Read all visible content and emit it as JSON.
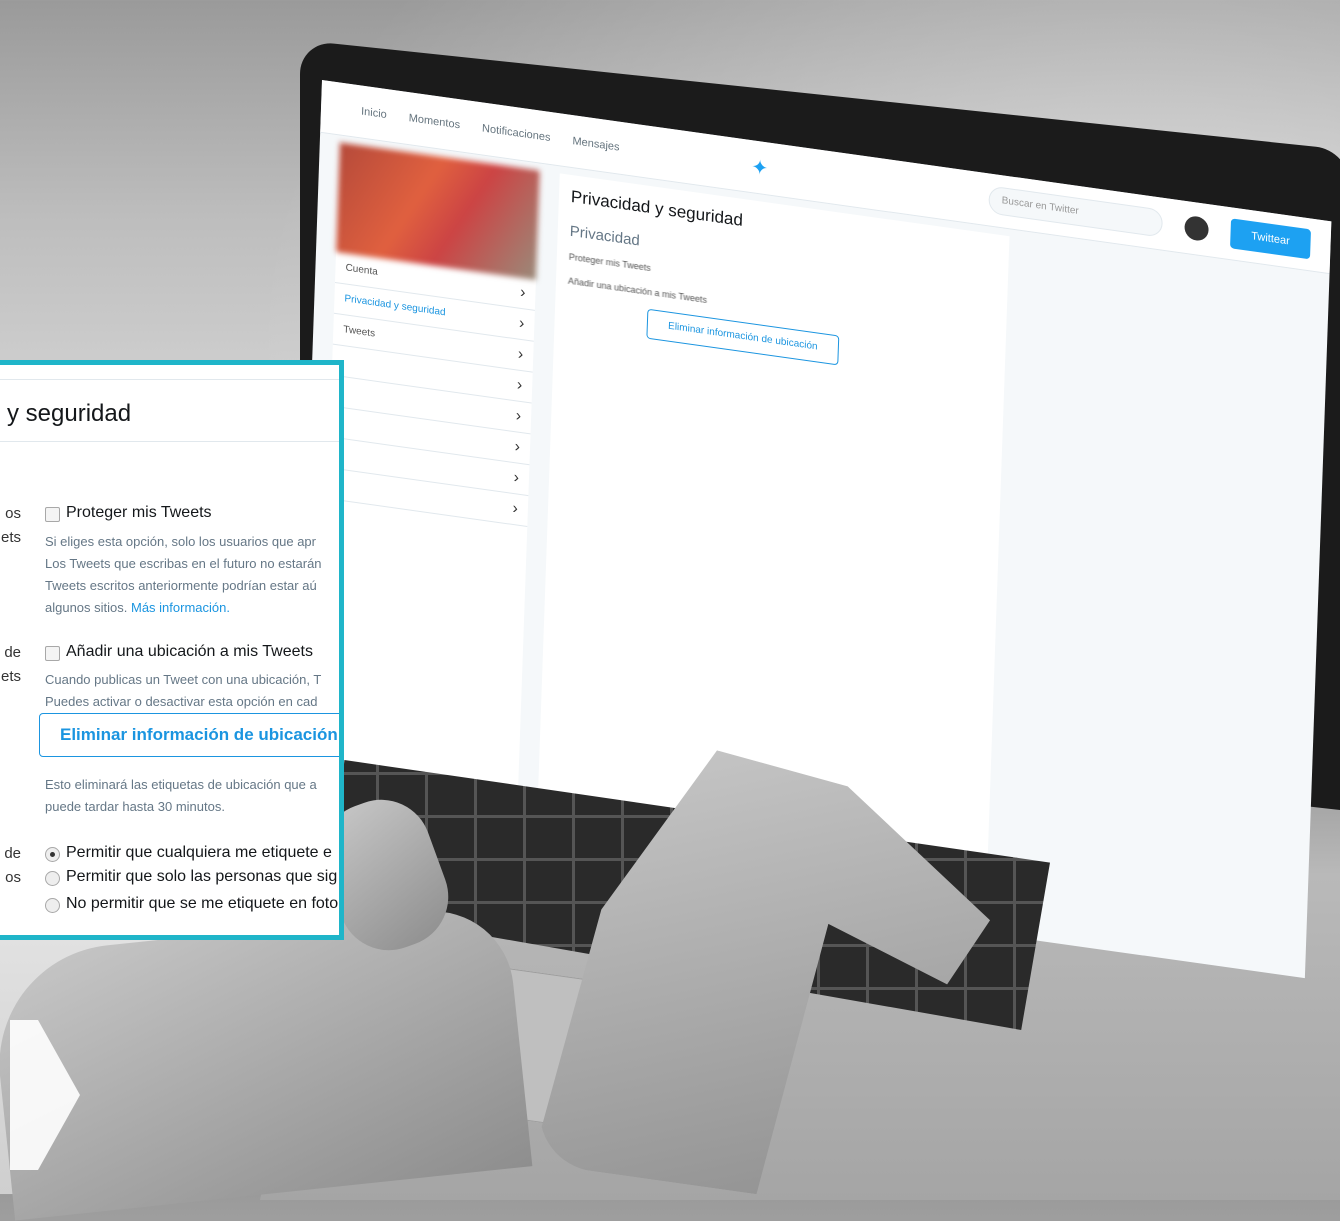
{
  "screen": {
    "nav": [
      "Inicio",
      "Momentos",
      "Notificaciones",
      "Mensajes"
    ],
    "search_placeholder": "Buscar en Twitter",
    "tweet_button": "Twittear",
    "sidebar": [
      "Cuenta",
      "Privacidad y seguridad",
      "Tweets"
    ],
    "title": "Privacidad y seguridad",
    "section": "Privacidad",
    "text1": "Proteger mis Tweets",
    "text2": "Añadir una ubicación a mis Tweets",
    "delete_button": "Eliminar información de ubicación"
  },
  "zoom": {
    "title": "y seguridad",
    "labels": {
      "privacy_1": "os",
      "privacy_2": "ets",
      "location_1": "de",
      "location_2": "ets",
      "photo_1": "de",
      "photo_2": "os"
    },
    "protect_tweets": {
      "label": "Proteger mis Tweets",
      "help": [
        "Si eliges esta opción, solo los usuarios que apr",
        "Los Tweets que escribas en el futuro no estarán",
        "Tweets escritos anteriormente podrían estar aú",
        "algunos sitios. "
      ],
      "more_link": "Más información."
    },
    "location": {
      "label": "Añadir una ubicación a mis Tweets",
      "help": [
        "Cuando publicas un Tweet con una ubicación, T",
        "Puedes activar o desactivar esta opción en cad"
      ],
      "delete_button": "Eliminar información de ubicación",
      "note": [
        "Esto eliminará las etiquetas de ubicación que a",
        "puede tardar hasta 30 minutos."
      ]
    },
    "photo_tagging": {
      "options": [
        "Permitir que cualquiera me etiquete e",
        "Permitir que solo las personas que sig",
        "No permitir que se me etiquete en foto"
      ],
      "selected_index": 0
    }
  }
}
